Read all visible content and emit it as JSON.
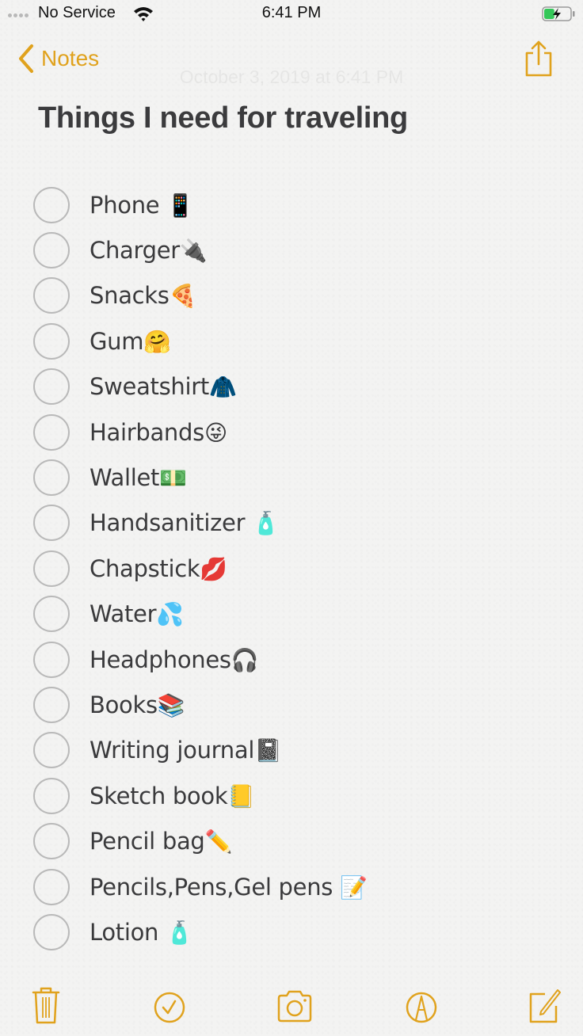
{
  "status_bar": {
    "carrier": "No Service",
    "time": "6:41 PM",
    "battery_level": 0.4,
    "battery_charging": true,
    "battery_color": "#34c759"
  },
  "nav": {
    "back_label": "Notes",
    "timestamp": "October 3, 2019 at 6:41 PM"
  },
  "accent_color": "#e0a21d",
  "note": {
    "title": "Things I need for traveling",
    "items": [
      {
        "text": "Phone ",
        "emoji": "📱",
        "checked": false
      },
      {
        "text": "Charger",
        "emoji": "🔌",
        "checked": false
      },
      {
        "text": "Snacks",
        "emoji": "🍕",
        "checked": false
      },
      {
        "text": "Gum",
        "emoji": "🤗",
        "checked": false
      },
      {
        "text": "Sweatshirt",
        "emoji": "🧥",
        "checked": false
      },
      {
        "text": "Hairbands",
        "emoji": "😜",
        "checked": false
      },
      {
        "text": "Wallet",
        "emoji": "💵",
        "checked": false
      },
      {
        "text": "Handsanitizer ",
        "emoji": "🧴",
        "checked": false
      },
      {
        "text": "Chapstick",
        "emoji": "💋",
        "checked": false
      },
      {
        "text": "Water",
        "emoji": "💦",
        "checked": false
      },
      {
        "text": "Headphones",
        "emoji": "🎧",
        "checked": false
      },
      {
        "text": "Books",
        "emoji": "📚",
        "checked": false
      },
      {
        "text": "Writing journal",
        "emoji": "📓",
        "checked": false
      },
      {
        "text": "Sketch book",
        "emoji": "📒",
        "checked": false
      },
      {
        "text": "Pencil bag",
        "emoji": "✏️",
        "checked": false
      },
      {
        "text": "Pencils,Pens,Gel pens ",
        "emoji": "📝",
        "checked": false
      },
      {
        "text": "Lotion ",
        "emoji": "🧴",
        "checked": false
      }
    ]
  },
  "toolbar": {
    "icons": [
      "trash-icon",
      "checklist-icon",
      "camera-icon",
      "markup-icon",
      "compose-icon"
    ]
  }
}
